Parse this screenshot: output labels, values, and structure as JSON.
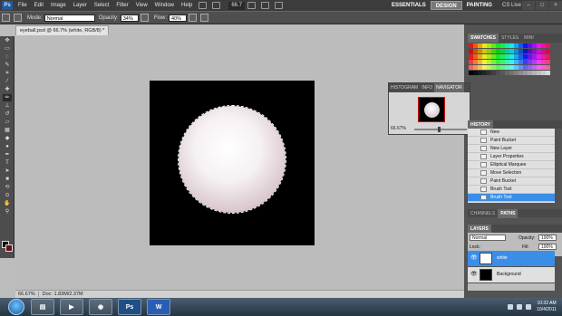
{
  "menubar": {
    "logo": "Ps",
    "items": [
      "File",
      "Edit",
      "Image",
      "Layer",
      "Select",
      "Filter",
      "View",
      "Window",
      "Help"
    ],
    "zoom": "66.7",
    "workspaces": [
      "ESSENTIALS",
      "DESIGN",
      "PAINTING"
    ],
    "active_workspace": "DESIGN",
    "cs_live": "CS Live"
  },
  "options": {
    "mode_label": "Mode:",
    "mode_value": "Normal",
    "opacity_label": "Opacity:",
    "opacity_value": "34%",
    "flow_label": "Flow:",
    "flow_value": "40%"
  },
  "document": {
    "tab_title": "eyeball.psd @ 66.7% (white, RGB/8) *",
    "zoom_status": "66.67%",
    "doc_status": "Doc: 1.83M/2.37M"
  },
  "navigator": {
    "tabs": [
      "HISTOGRAM",
      "INFO",
      "NAVIGATOR"
    ],
    "active_tab": "NAVIGATOR",
    "zoom": "66.67%"
  },
  "swatches": {
    "tabs": [
      "SWATCHES",
      "STYLES",
      "MINI"
    ],
    "active_tab": "SWATCHES"
  },
  "history": {
    "tab": "HISTORY",
    "items": [
      "New",
      "Paint Bucket",
      "New Layer",
      "Layer Properties",
      "Elliptical Marquee",
      "Move Selection",
      "Paint Bucket",
      "Brush Tool",
      "Brush Tool"
    ],
    "active_index": 8
  },
  "channels": {
    "tabs": [
      "CHANNELS",
      "PATHS"
    ]
  },
  "layers": {
    "tab": "LAYERS",
    "blend_mode": "Normal",
    "opacity_label": "Opacity:",
    "opacity": "100%",
    "lock_label": "Lock:",
    "fill_label": "Fill:",
    "fill": "100%",
    "items": [
      {
        "name": "white",
        "selected": true
      },
      {
        "name": "Background",
        "selected": false
      }
    ]
  },
  "taskbar": {
    "apps": [
      "Explorer",
      "Media",
      "Firefox",
      "Ps",
      "W"
    ],
    "time": "10:32 AM",
    "date": "10/4/2011"
  },
  "colors": {
    "foreground": "#1a0000",
    "background": "#6b0e0e",
    "accent": "#3b8ee8"
  }
}
